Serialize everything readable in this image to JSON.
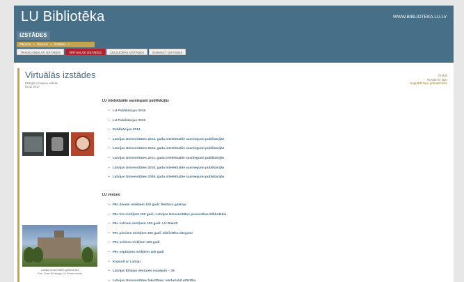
{
  "site": {
    "title": "LU Bibliotēka",
    "url": "WWW.BIBLIOTEKA.LU.LV"
  },
  "section": {
    "label": "IZSTĀDES"
  },
  "breadcrumb": [
    "Sākums",
    "»",
    "Resursi",
    "»",
    "Izstādes",
    "»"
  ],
  "tabs": [
    {
      "label": "TRADICIONĀLĀS IZSTĀDES",
      "active": false
    },
    {
      "label": "VIRTUĀLĀS IZSTĀDES",
      "active": true
    },
    {
      "label": "CEĻOJOŠĀS IZSTĀDES",
      "active": false
    },
    {
      "label": "IESNIEGT IZSTĀDES",
      "active": false
    }
  ],
  "page": {
    "title": "Virtuālās izstādes",
    "meta_line1": "Pēdējās izmaiņas veiktas",
    "meta_line2": "08.12.2017"
  },
  "side_links": [
    "Drukāt",
    "Nosūtīt šo lapu",
    "Saglabāt lapu grāmatzīmēs"
  ],
  "groups": [
    {
      "heading": "LU intelektuālie sasniegumi publikācijās",
      "items": [
        "LU Publikācijas 2016",
        "LU Publikācijas 2015",
        "Publikācijas 2014",
        "Latvijas Universitātes 2013. gada intelektuālie sasniegumi publikācijās",
        "Latvijas Universitātes 2012. gada intelektuālie sasniegumi publikācijās",
        "Latvijas Universitātes 2011. gada intelektuālie sasniegumi publikācijās",
        "Latvijas Universitātes 2010. gada intelektuālie sasniegumi publikācijās",
        "Latvijas Universitātes 2009. gada intelektuālie sasniegumi publikācijās"
      ]
    },
    {
      "heading": "LU vēsture",
      "items": [
        "Pēc diviem mirkļiem 100 gadi: Rektoru galerija",
        "Pēc trīs mirkļiem 100 gadi: Latvijas Universitātes personības Bibliotēkai",
        "Pēc četriem mirkļiem 100 gadi: LU Rakstī",
        "Pēc pieciem mirkļiem 100 gadi: bibliotēku dārgumi",
        "Pēc sešiem mirkļiem 100 gadi",
        "Pēc septiņiem mirkļiem 100 gadi",
        "Kopsolī ar Latviju",
        "Latvijas ķīmijas vēstures muzejam – 35",
        "Latvijas Universitātes fakultātes: vēsturiskā attīstība"
      ]
    }
  ],
  "photo_caption": {
    "line1": "Latvijas Universitātes galvenā ēka",
    "line2": "Foto: Toms Grīnbergs, LU Preses centrs"
  },
  "colors": {
    "header": "#476f87",
    "accent_gold": "#c4a54e",
    "active_tab": "#b0222e",
    "link": "#476f87"
  }
}
